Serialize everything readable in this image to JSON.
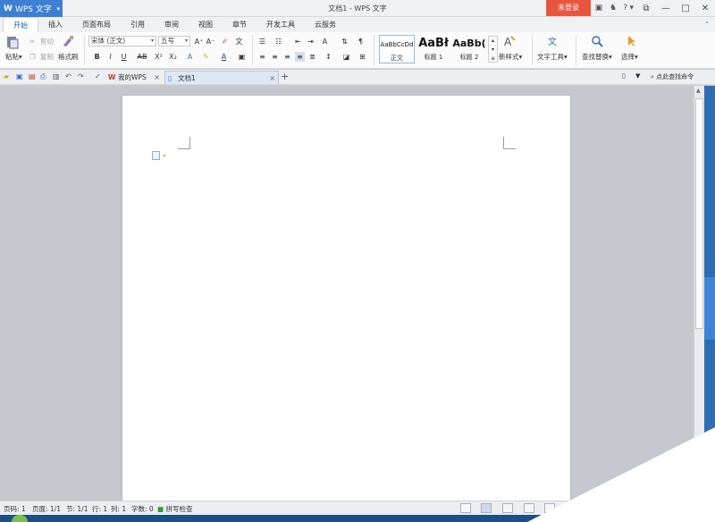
{
  "titlebar": {
    "app_name": "WPS 文字",
    "app_logo": "W",
    "document_title": "文档1 - WPS 文字",
    "login_label": "未登录",
    "icons": [
      "skin-icon",
      "shirt-icon",
      "help-icon"
    ],
    "help_label": "?"
  },
  "menu_tabs": [
    "开始",
    "插入",
    "页面布局",
    "引用",
    "审阅",
    "视图",
    "章节",
    "开发工具",
    "云服务"
  ],
  "ribbon": {
    "paste_label": "粘贴",
    "cut_label": "剪切",
    "copy_label": "复制",
    "format_painter_label": "格式刷",
    "font_name": "宋体 (正文)",
    "font_size": "五号",
    "styles": [
      {
        "preview": "AaBbCcDd",
        "label": "正文"
      },
      {
        "preview": "AaBł",
        "label": "标题 1"
      },
      {
        "preview": "AaBb(",
        "label": "标题 2"
      }
    ],
    "new_style_label": "新样式",
    "text_tools_label": "文字工具",
    "find_replace_label": "查找替换",
    "select_label": "选择"
  },
  "quickbar": {
    "tabs": [
      {
        "label": "我的WPS"
      },
      {
        "label": "文档1"
      }
    ],
    "add_tab_label": "+",
    "search_command_label": "点此查找命令"
  },
  "statusbar": {
    "page_code": "页码: 1",
    "pages": "页面: 1/1",
    "section": "节: 1/1",
    "row": "行: 1",
    "col": "列: 1",
    "word_count": "字数: 0",
    "spell_check": "拼写检查"
  },
  "colors": {
    "app_blue": "#3d7fd2",
    "login_red": "#e8563f",
    "canvas_gray": "#c5c9cf",
    "side_blue": "#2e6db3"
  }
}
